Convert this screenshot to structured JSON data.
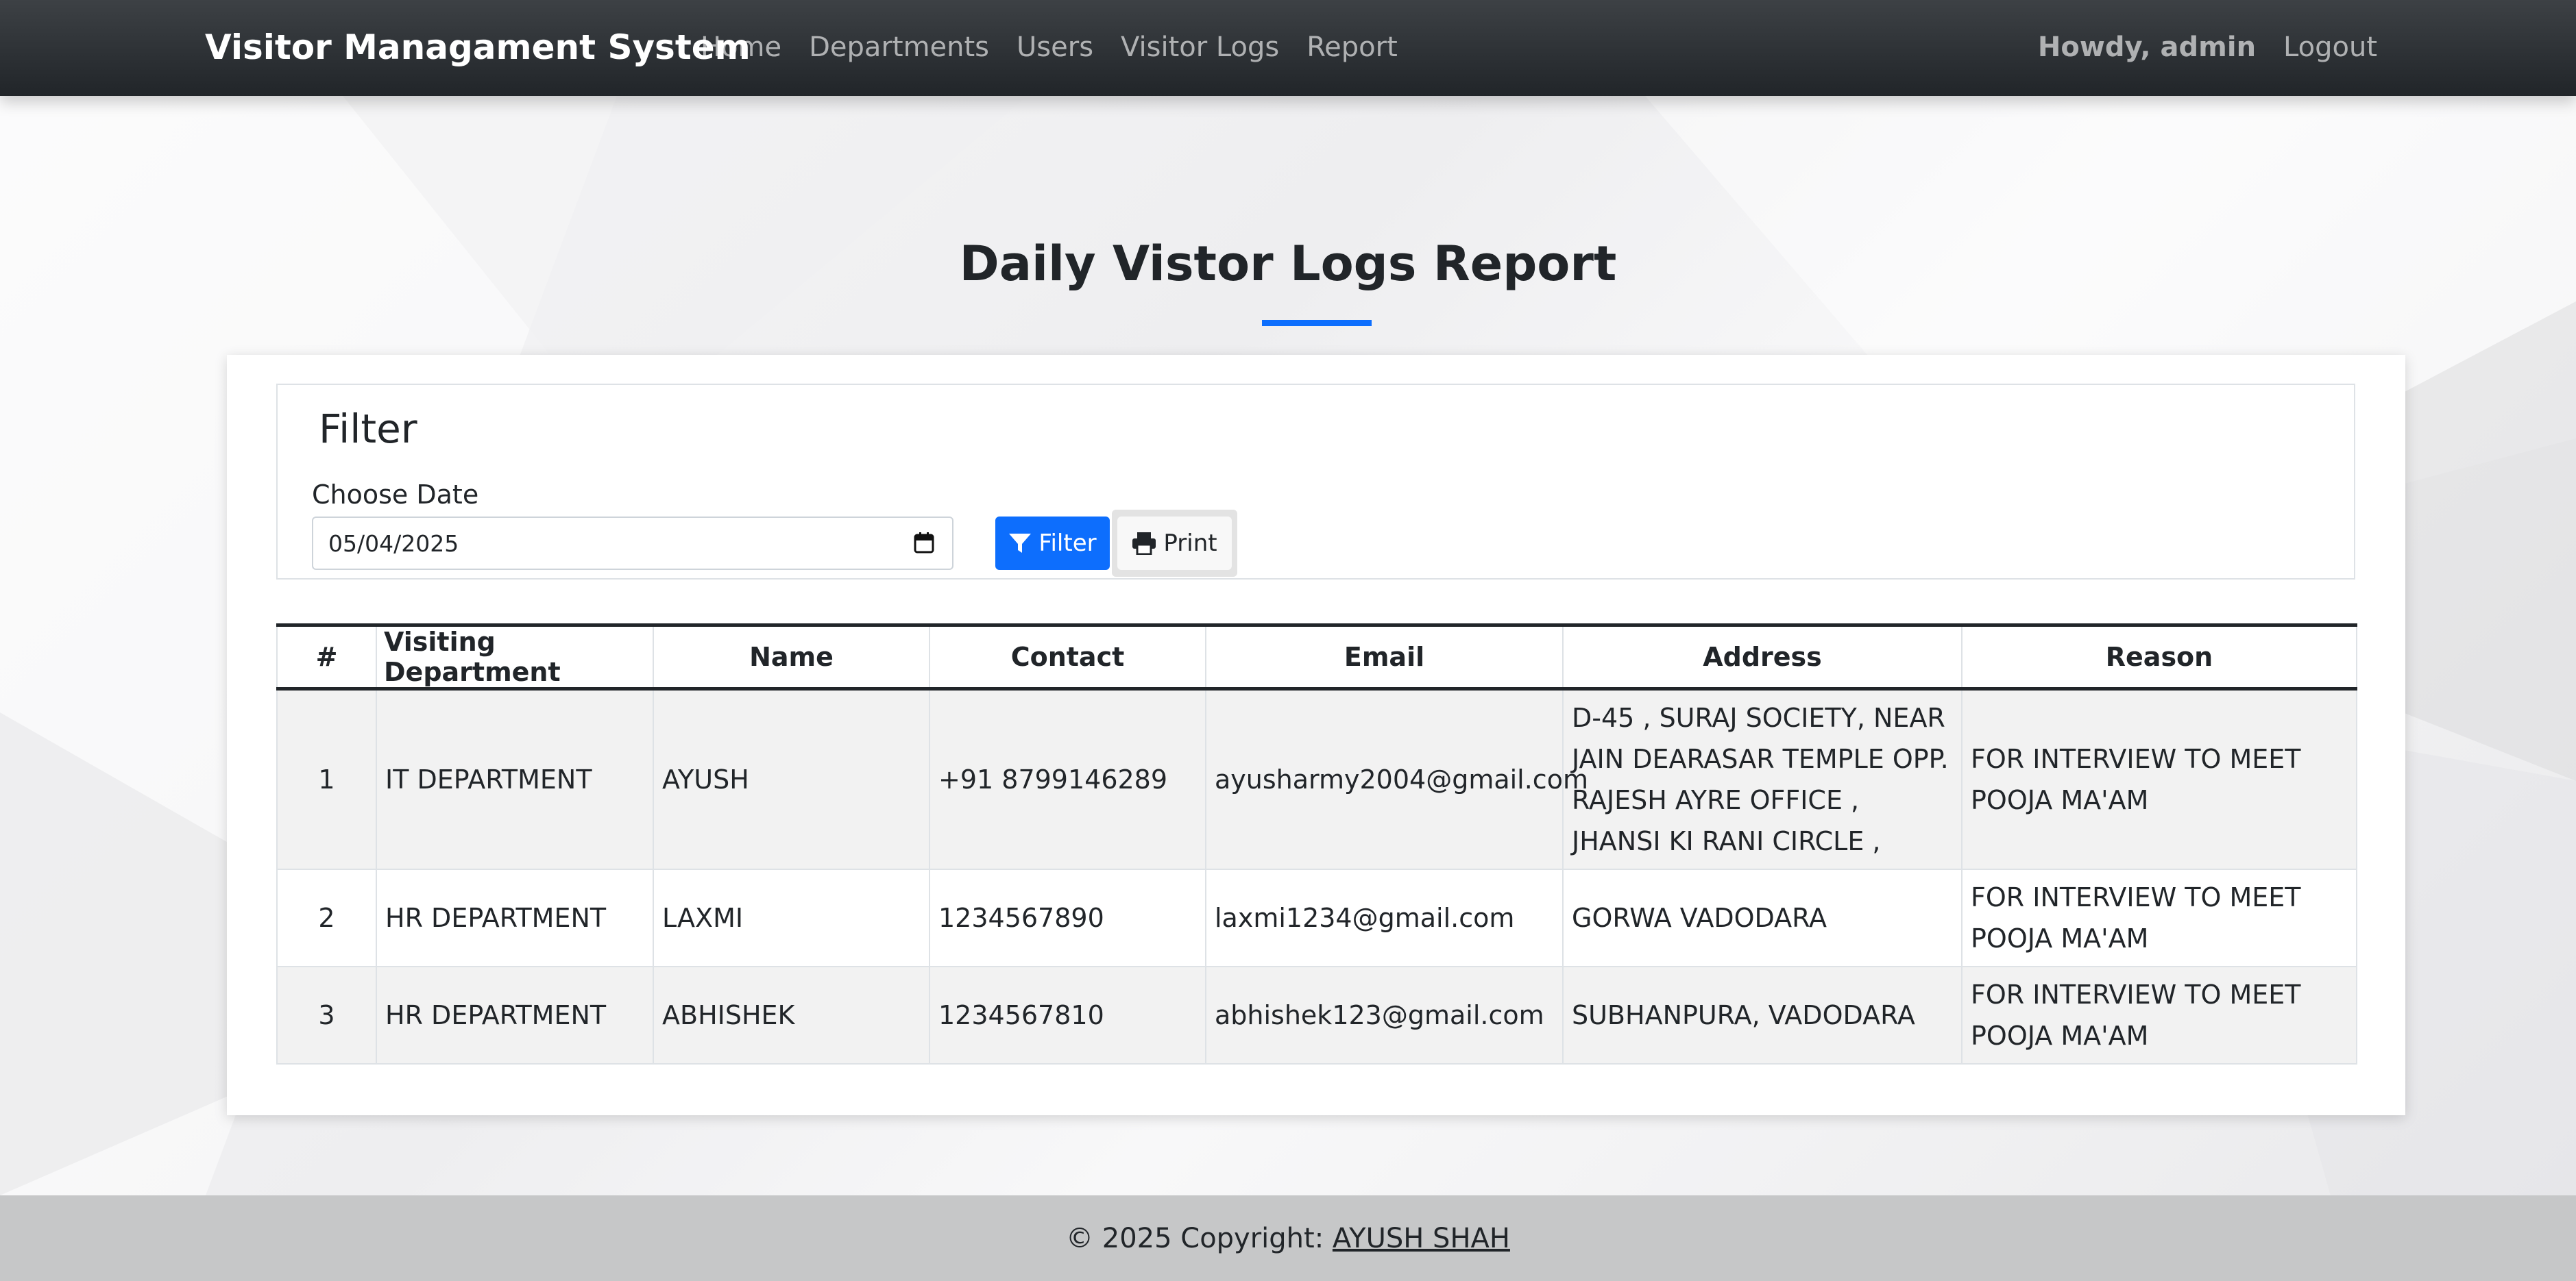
{
  "navbar": {
    "brand": "Visitor Managament System",
    "links": [
      "Home",
      "Departments",
      "Users",
      "Visitor Logs",
      "Report"
    ],
    "greeting": "Howdy, admin",
    "logout": "Logout"
  },
  "page": {
    "title": "Daily Vistor Logs Report"
  },
  "filter": {
    "heading": "Filter",
    "date_label": "Choose Date",
    "date_value": "05/04/2025",
    "filter_button": "Filter",
    "print_button": "Print"
  },
  "table": {
    "headers": [
      "#",
      "Visiting Department",
      "Name",
      "Contact",
      "Email",
      "Address",
      "Reason"
    ],
    "rows": [
      {
        "num": "1",
        "department": "IT DEPARTMENT",
        "name": "AYUSH",
        "contact": "+91 8799146289",
        "email": "ayusharmy2004@gmail.com",
        "address": "D-45 , SURAJ SOCIETY, NEAR JAIN DEARASAR TEMPLE OPP. RAJESH AYRE OFFICE , JHANSI KI RANI CIRCLE ,",
        "reason": "FOR INTERVIEW TO MEET POOJA MA'AM"
      },
      {
        "num": "2",
        "department": "HR DEPARTMENT",
        "name": "LAXMI",
        "contact": "1234567890",
        "email": "laxmi1234@gmail.com",
        "address": "GORWA VADODARA",
        "reason": "FOR INTERVIEW TO MEET POOJA MA'AM"
      },
      {
        "num": "3",
        "department": "HR DEPARTMENT",
        "name": "ABHISHEK",
        "contact": "1234567810",
        "email": "abhishek123@gmail.com",
        "address": "SUBHANPURA, VADODARA",
        "reason": "FOR INTERVIEW TO MEET POOJA MA'AM"
      }
    ]
  },
  "footer": {
    "copyright": "© 2025 Copyright:",
    "author": "AYUSH SHAH"
  },
  "colors": {
    "accent": "#0d6efd",
    "navbar": "#212529",
    "footer": "#c6c7c8"
  },
  "icons": [
    "calendar-icon",
    "filter-icon",
    "print-icon"
  ]
}
